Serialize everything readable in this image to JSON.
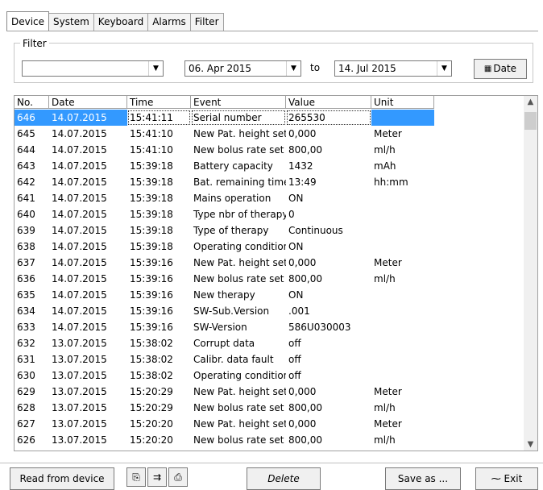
{
  "tabs": [
    "Device",
    "System",
    "Keyboard",
    "Alarms",
    "Filter"
  ],
  "filter": {
    "legend": "Filter",
    "event_select": "",
    "from_date": "06. Apr 2015",
    "to_label": "to",
    "to_date": "14. Jul 2015",
    "date_button": "Date"
  },
  "table": {
    "headers": [
      "No.",
      "Date",
      "Time",
      "Event",
      "Value",
      "Unit"
    ],
    "rows": [
      [
        "646",
        "14.07.2015",
        "15:41:11",
        "Serial number",
        "265530",
        ""
      ],
      [
        "645",
        "14.07.2015",
        "15:41:10",
        "New Pat. height set",
        "0,000",
        "Meter"
      ],
      [
        "644",
        "14.07.2015",
        "15:41:10",
        "New bolus rate set",
        "800,00",
        "ml/h"
      ],
      [
        "643",
        "14.07.2015",
        "15:39:18",
        "Battery capacity",
        "1432",
        "mAh"
      ],
      [
        "642",
        "14.07.2015",
        "15:39:18",
        "Bat. remaining time",
        "13:49",
        "hh:mm"
      ],
      [
        "641",
        "14.07.2015",
        "15:39:18",
        "Mains operation",
        "ON",
        ""
      ],
      [
        "640",
        "14.07.2015",
        "15:39:18",
        "Type nbr of therapy",
        "0",
        ""
      ],
      [
        "639",
        "14.07.2015",
        "15:39:18",
        "Type of therapy",
        "Continuous",
        ""
      ],
      [
        "638",
        "14.07.2015",
        "15:39:18",
        "Operating condition",
        "ON",
        ""
      ],
      [
        "637",
        "14.07.2015",
        "15:39:16",
        "New Pat. height set",
        "0,000",
        "Meter"
      ],
      [
        "636",
        "14.07.2015",
        "15:39:16",
        "New bolus rate set",
        "800,00",
        "ml/h"
      ],
      [
        "635",
        "14.07.2015",
        "15:39:16",
        "New therapy",
        "ON",
        ""
      ],
      [
        "634",
        "14.07.2015",
        "15:39:16",
        "SW-Sub.Version",
        ".001",
        ""
      ],
      [
        "633",
        "14.07.2015",
        "15:39:16",
        "SW-Version",
        "586U030003",
        ""
      ],
      [
        "632",
        "13.07.2015",
        "15:38:02",
        "Corrupt data",
        "off",
        ""
      ],
      [
        "631",
        "13.07.2015",
        "15:38:02",
        "Calibr. data fault",
        "off",
        ""
      ],
      [
        "630",
        "13.07.2015",
        "15:38:02",
        "Operating condition",
        "off",
        ""
      ],
      [
        "629",
        "13.07.2015",
        "15:20:29",
        "New Pat. height set",
        "0,000",
        "Meter"
      ],
      [
        "628",
        "13.07.2015",
        "15:20:29",
        "New bolus rate set",
        "800,00",
        "ml/h"
      ],
      [
        "627",
        "13.07.2015",
        "15:20:20",
        "New Pat. height set",
        "0,000",
        "Meter"
      ],
      [
        "626",
        "13.07.2015",
        "15:20:20",
        "New bolus rate set",
        "800,00",
        "ml/h"
      ]
    ]
  },
  "footer": {
    "read_button": "Read from device",
    "delete_button": "Delete",
    "save_button": "Save as ...",
    "exit_button": "Exit"
  },
  "colors": {
    "selection": "#3399ff"
  }
}
